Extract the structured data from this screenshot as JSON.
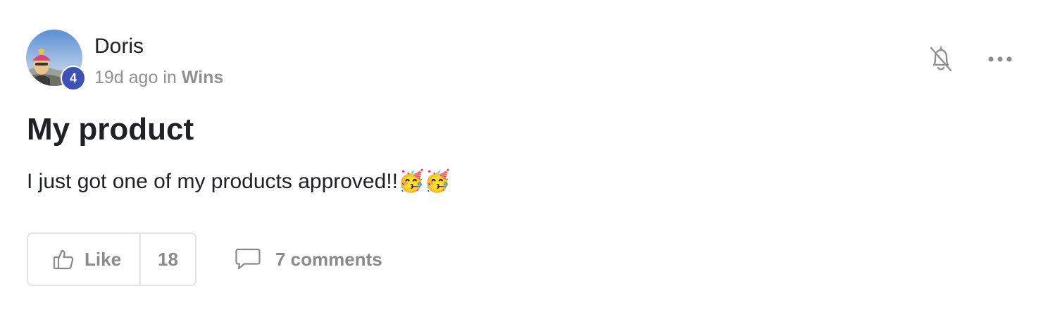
{
  "post": {
    "author": {
      "name": "Doris",
      "level": "4",
      "level_color": "#3f51b5"
    },
    "meta": {
      "time": "19d ago",
      "in": "in",
      "category": "Wins"
    },
    "title": "My product",
    "body": "I just got one of my products approved!!🥳🥳",
    "actions": {
      "like_label": "Like",
      "like_count": "18",
      "comments_label": "7 comments"
    },
    "icons": {
      "notifications": "bell-off-icon",
      "more": "more-horizontal-icon",
      "like": "thumbs-up-icon",
      "comments": "comment-icon"
    }
  }
}
